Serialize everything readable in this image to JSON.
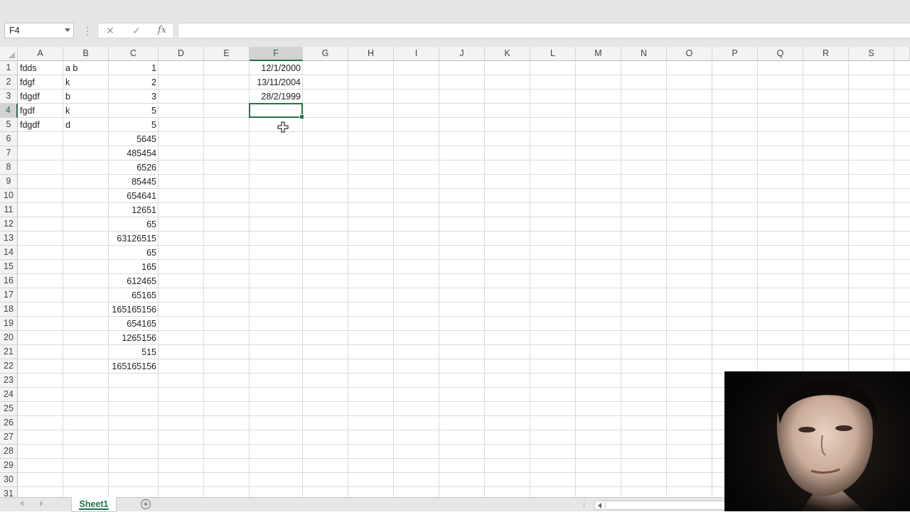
{
  "formula_bar": {
    "name_box": "F4",
    "cancel_symbol": "✕",
    "enter_symbol": "✓",
    "fx_label": "fx",
    "formula_value": ""
  },
  "columns": [
    "A",
    "B",
    "C",
    "D",
    "E",
    "F",
    "G",
    "H",
    "I",
    "J",
    "K",
    "L",
    "M",
    "N",
    "O",
    "P",
    "Q",
    "R",
    "S"
  ],
  "active_column": "F",
  "rows": [
    "1",
    "2",
    "3",
    "4",
    "5",
    "6",
    "7",
    "8",
    "9",
    "10",
    "11",
    "12",
    "13",
    "14",
    "15",
    "16",
    "17",
    "18",
    "19",
    "20",
    "21",
    "22",
    "23",
    "24",
    "25",
    "26",
    "27",
    "28",
    "29",
    "30",
    "31"
  ],
  "active_row": "4",
  "cells": {
    "A": [
      "fdds",
      "fdgf",
      "fdgdf",
      "fgdf",
      "fdgdf"
    ],
    "B": [
      "a b",
      "k",
      "b",
      "k",
      "d"
    ],
    "C": [
      "1",
      "2",
      "3",
      "5",
      "5",
      "5645",
      "485454",
      "6526",
      "85445",
      "654641",
      "12651",
      "65",
      "63126515",
      "65",
      "165",
      "612465",
      "65165",
      "165165156",
      "654165",
      "1265156",
      "515",
      "165165156"
    ],
    "F": [
      "12/1/2000",
      "13/11/2004",
      "28/2/1999"
    ]
  },
  "selected_cell": "F4",
  "sheets": {
    "tabs": [
      "Sheet1"
    ],
    "active": "Sheet1",
    "add_symbol": "+"
  },
  "overlay": {
    "type": "webcam",
    "icon": "person-webcam"
  },
  "colors": {
    "accent": "#217346",
    "header_bg": "#f3f3f3",
    "ribbon_bg": "#e6e6e6"
  }
}
